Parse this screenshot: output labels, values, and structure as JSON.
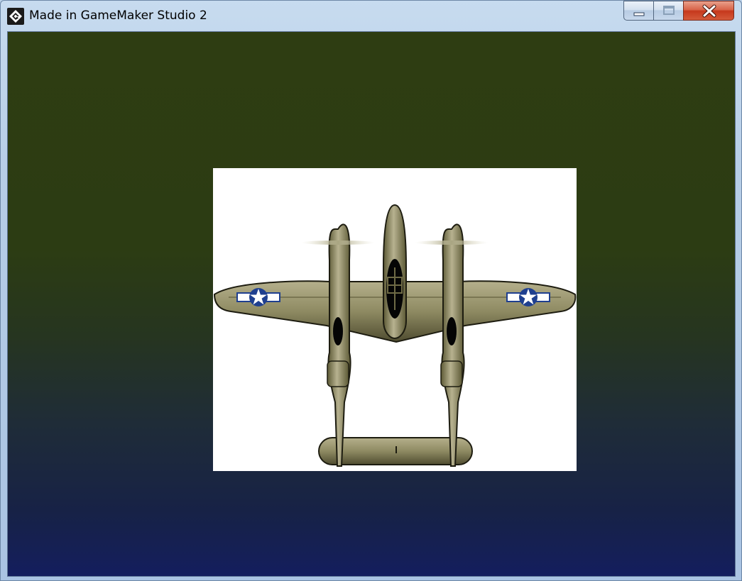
{
  "window": {
    "title": "Made in GameMaker Studio 2",
    "app_icon": "gamemaker-icon",
    "caption_buttons": {
      "minimize": "minimize-icon",
      "maximize": "maximize-icon",
      "close": "close-icon"
    }
  },
  "game": {
    "background_gradient": [
      "#2e3d12",
      "#141e5e"
    ],
    "sprite": {
      "name": "p38-lightning-plane",
      "background": "#ffffff",
      "aircraft_color": "#8c8760",
      "insignia_color": "#1f3f8f"
    }
  }
}
